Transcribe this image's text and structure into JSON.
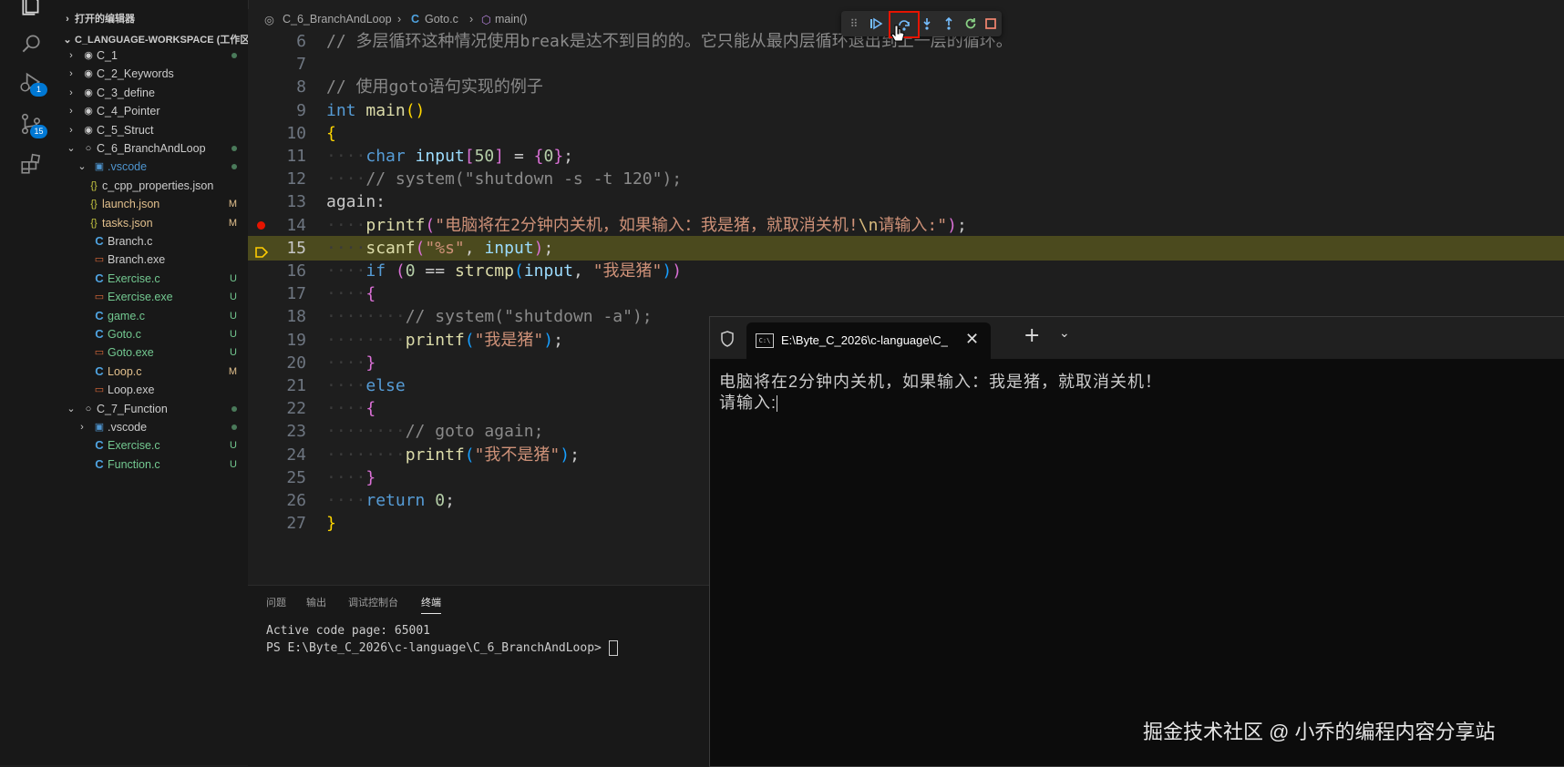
{
  "sidebar": {
    "open_editors": "打开的编辑器",
    "workspace": "C_LANGUAGE-WORKSPACE (工作区)",
    "items": [
      {
        "label": "C_1",
        "badge": ""
      },
      {
        "label": "C_2_Keywords",
        "badge": ""
      },
      {
        "label": "C_3_define",
        "badge": ""
      },
      {
        "label": "C_4_Pointer",
        "badge": ""
      },
      {
        "label": "C_5_Struct",
        "badge": ""
      },
      {
        "label": "C_6_BranchAndLoop",
        "badge": ""
      },
      {
        "label": ".vscode",
        "badge": ""
      },
      {
        "label": "c_cpp_properties.json",
        "badge": ""
      },
      {
        "label": "launch.json",
        "badge": "M"
      },
      {
        "label": "tasks.json",
        "badge": "M"
      },
      {
        "label": "Branch.c",
        "badge": ""
      },
      {
        "label": "Branch.exe",
        "badge": ""
      },
      {
        "label": "Exercise.c",
        "badge": "U"
      },
      {
        "label": "Exercise.exe",
        "badge": "U"
      },
      {
        "label": "game.c",
        "badge": "U"
      },
      {
        "label": "Goto.c",
        "badge": "U"
      },
      {
        "label": "Goto.exe",
        "badge": "U"
      },
      {
        "label": "Loop.c",
        "badge": "M"
      },
      {
        "label": "Loop.exe",
        "badge": ""
      },
      {
        "label": "C_7_Function",
        "badge": ""
      },
      {
        "label": ".vscode",
        "badge": ""
      },
      {
        "label": "Exercise.c",
        "badge": "U"
      },
      {
        "label": "Function.c",
        "badge": "U"
      }
    ]
  },
  "activity": {
    "debug_badge": "1",
    "scm_badge": "15"
  },
  "breadcrumb": {
    "folder": "C_6_BranchAndLoop",
    "file": "Goto.c",
    "symbol": "main()"
  },
  "editor": {
    "line_numbers": [
      "6",
      "7",
      "8",
      "9",
      "10",
      "11",
      "12",
      "13",
      "14",
      "15",
      "16",
      "17",
      "18",
      "19",
      "20",
      "21",
      "22",
      "23",
      "24",
      "25",
      "26",
      "27"
    ],
    "l6": "// 多层循环这种情况使用break是达不到目的的。它只能从最内层循环退出到上一层的循环。",
    "l8": "// 使用goto语句实现的例子",
    "l12": "// system(\"shutdown -s -t 120\");",
    "l14_str": "\"电脑将在2分钟内关机，如果输入：我是猪，就取消关机!",
    "l14_esc": "\\n",
    "l14_str2": "请输入:\"",
    "l18": "// system(\"shutdown -a\");",
    "l19_str": "\"我是猪\"",
    "l23": "// goto again;",
    "l24_str": "\"我不是猪\""
  },
  "panel": {
    "tabs": [
      "问题",
      "输出",
      "调试控制台",
      "终端"
    ],
    "terminal_lines": [
      "Active code page: 65001",
      "PS E:\\Byte_C_2026\\c-language\\C_6_BranchAndLoop> "
    ]
  },
  "console": {
    "tab_title": "E:\\Byte_C_2026\\c-language\\C_",
    "output": [
      "电脑将在2分钟内关机，如果输入：我是猪，就取消关机！",
      "请输入:"
    ]
  },
  "watermark": "掘金技术社区 @ 小乔的编程内容分享站"
}
